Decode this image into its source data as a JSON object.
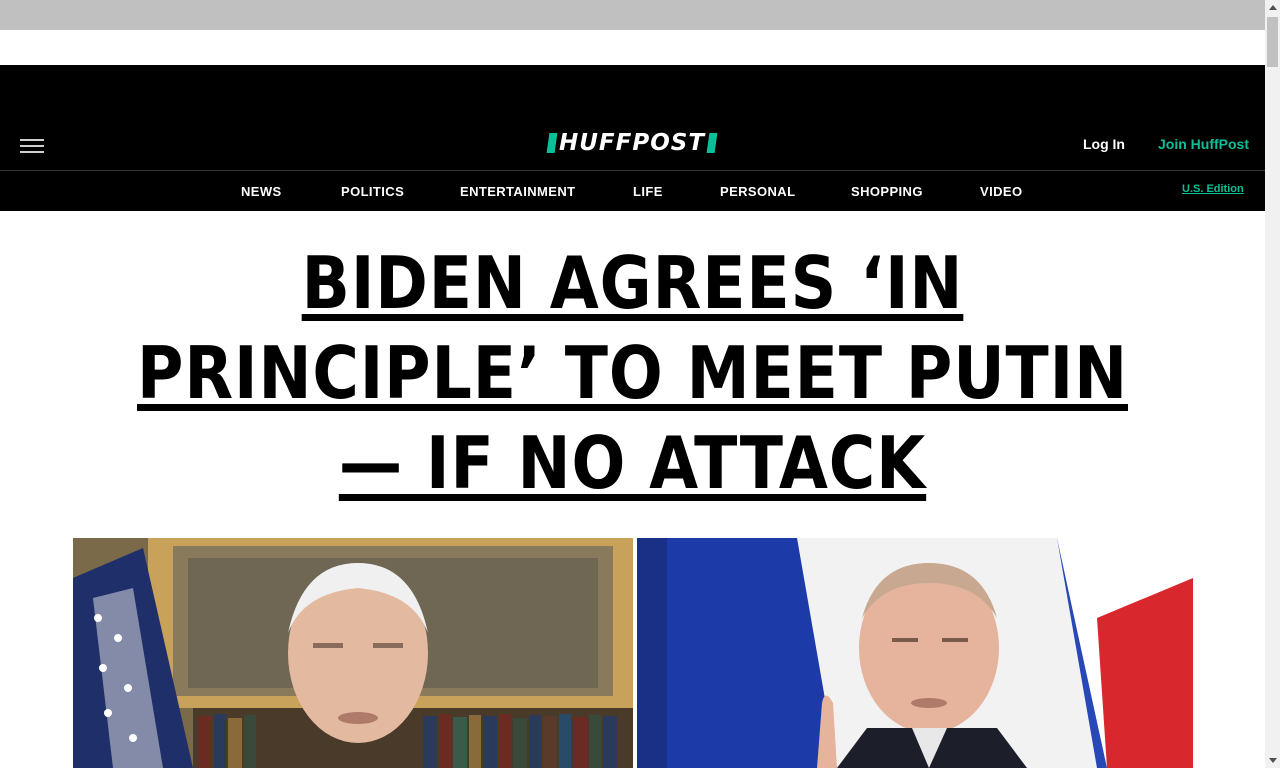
{
  "header": {
    "logo_text": "HUFFPOST",
    "login_label": "Log In",
    "join_label": "Join HuffPost",
    "brand_color": "#0dbe98"
  },
  "nav": {
    "items": [
      "NEWS",
      "POLITICS",
      "ENTERTAINMENT",
      "LIFE",
      "PERSONAL",
      "SHOPPING",
      "VIDEO"
    ],
    "edition_label": "U.S. Edition"
  },
  "article": {
    "headline": "BIDEN AGREES ‘IN PRINCIPLE’ TO MEET PUTIN — IF NO ATTACK"
  },
  "icons": {
    "menu": "hamburger-menu-icon",
    "scroll_up": "scroll-up-arrow-icon",
    "scroll_down": "scroll-down-arrow-icon"
  }
}
